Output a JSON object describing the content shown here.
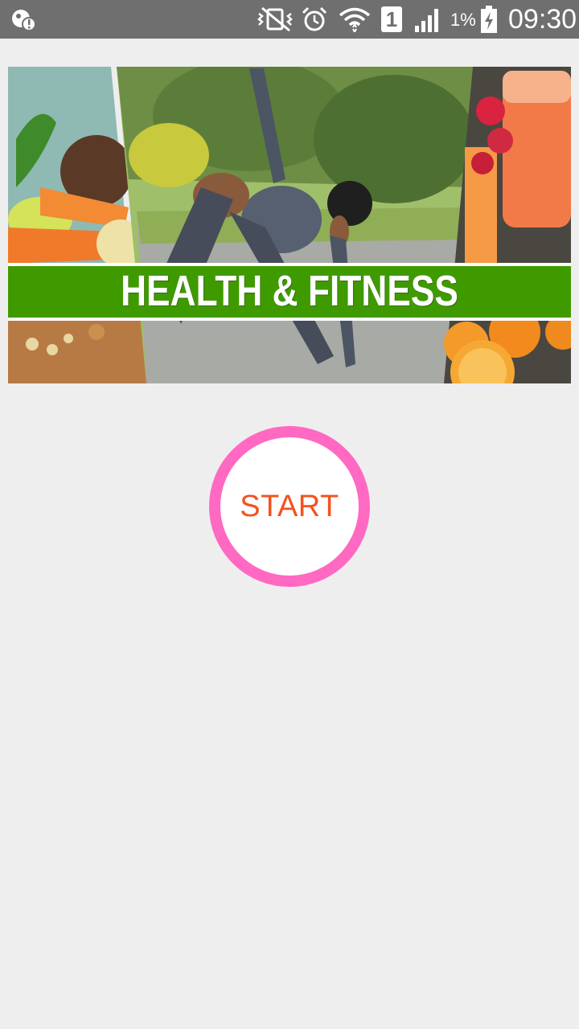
{
  "status_bar": {
    "battery_percent": "1%",
    "time": "09:30",
    "sim_slot": "1",
    "icons": [
      "notification-icon",
      "vibrate-muted-icon",
      "alarm-icon",
      "wifi-icon",
      "sim-1-icon",
      "signal-icon",
      "battery-charging-icon"
    ]
  },
  "banner": {
    "title": "HEALTH & FITNESS",
    "accent_green": "#3f9a00"
  },
  "start_button": {
    "label": "START",
    "ring_color": "#ff69c2",
    "text_color": "#f4511e"
  }
}
